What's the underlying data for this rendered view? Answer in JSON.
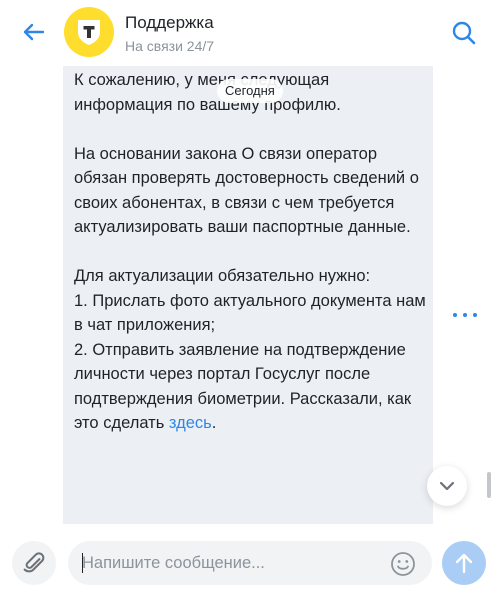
{
  "header": {
    "back_icon": "arrow-left-icon",
    "avatar_icon": "tinkoff-shield-logo",
    "title": "Поддержка",
    "subtitle": "На связи 24/7",
    "search_icon": "search-icon"
  },
  "chat": {
    "date_chip": "Сегодня",
    "message": {
      "text": "К сожалению, у меня следующая информация по вашему профилю.\n\nНа основании закона О связи оператор обязан проверять достоверность сведений о своих абонентах, в связи с чем требуется актуализировать ваши паспортные данные.\n\nДля актуализации обязательно нужно:\n1. Прислать фото актуального документа нам в чат приложения;\n2. Отправить заявление на подтверждение личности через портал Госуслуг после подтверждения биометрии. Рассказали, как это сделать ",
      "link_text": "здесь",
      "after_link": "."
    },
    "more_icon": "more-horizontal-icon",
    "scroll_down_icon": "chevron-down-icon"
  },
  "composer": {
    "attach_icon": "paperclip-icon",
    "placeholder": "Напишите сообщение...",
    "value": "",
    "emoji_icon": "smile-icon",
    "send_icon": "arrow-up-icon"
  },
  "colors": {
    "accent": "#2e87e6",
    "brand_yellow": "#ffdd2d",
    "bubble_bg": "#eceff3",
    "send_disabled": "#aacdf5"
  }
}
